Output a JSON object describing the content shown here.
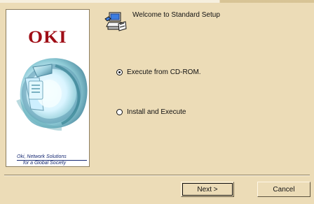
{
  "window": {
    "title": "Welcome to Standard Setup"
  },
  "branding": {
    "logo_text": "OKI",
    "slogan_line1": "Oki, Network Solutions",
    "slogan_line2": "for a Global Society"
  },
  "options": [
    {
      "label": "Execute from CD-ROM.",
      "selected": true
    },
    {
      "label": "Install and Execute",
      "selected": false
    }
  ],
  "buttons": {
    "next_label": "Next >",
    "cancel_label": "Cancel"
  },
  "icons": {
    "header_icon": "setup-computer-icon",
    "radio_checked": "radio-checked-icon",
    "radio_unchecked": "radio-unchecked-icon"
  }
}
